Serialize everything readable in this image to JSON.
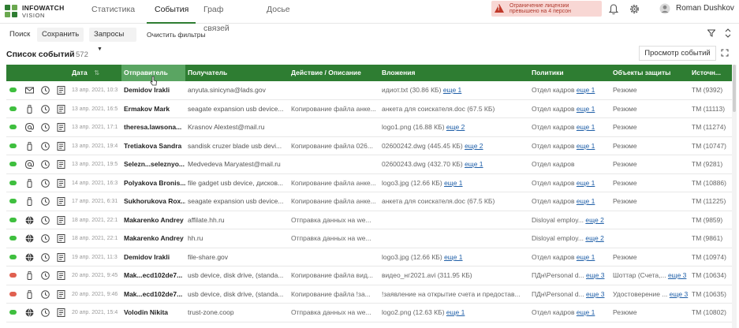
{
  "app": {
    "logo_line1": "INFOWATCH",
    "logo_line2": "VISION",
    "brand_color": "#2e7d32"
  },
  "nav": {
    "items": [
      {
        "label": "Статистика",
        "active": false
      },
      {
        "label": "События",
        "active": true
      },
      {
        "label": "Граф связей",
        "active": false
      },
      {
        "label": "Досье",
        "active": false
      }
    ]
  },
  "license_warning": {
    "line1": "Ограничение лицензии",
    "line2": "превышено на 4 персон"
  },
  "user": {
    "name": "Roman Dushkov"
  },
  "toolbar": {
    "search_label": "Поиск",
    "save_label": "Сохранить",
    "queries_label": "Запросы",
    "clear_filters_label": "Очистить фильтры"
  },
  "list": {
    "title": "Список событий",
    "count": "572",
    "view_button": "Просмотр событий"
  },
  "table": {
    "columns": [
      {
        "key": "date",
        "label": "Дата"
      },
      {
        "key": "sender",
        "label": "Отправитель"
      },
      {
        "key": "recipient",
        "label": "Получатель"
      },
      {
        "key": "action",
        "label": "Действие / Описание"
      },
      {
        "key": "attachments",
        "label": "Вложения"
      },
      {
        "key": "policies",
        "label": "Политики"
      },
      {
        "key": "objects",
        "label": "Объекты защиты"
      },
      {
        "key": "source",
        "label": "Источн..."
      }
    ],
    "sorted_column": "sender",
    "rows": [
      {
        "tag": "green",
        "channel": "mail-icon",
        "date": "13 апр. 2021, 10:3",
        "sender": "Demidov Irakli",
        "recipient": "anyuta.sinicyna@lads.gov",
        "action": "",
        "attachment": "идиот.txt (30.86 КБ)",
        "attachment_more": "еще 1",
        "policy": "Отдел кадров",
        "policy_more": "еще 1",
        "object": "Резюме",
        "object_more": "",
        "source": "TM (9392)"
      },
      {
        "tag": "green",
        "channel": "usb-icon",
        "date": "13 апр. 2021, 16:5",
        "sender": "Ermakov Mark",
        "recipient": "seagate expansion usb device...",
        "action": "Копирование файла анке...",
        "attachment": "анкета для соискателя.doc (67.5 КБ)",
        "attachment_more": "",
        "policy": "Отдел кадров",
        "policy_more": "еще 1",
        "object": "Резюме",
        "object_more": "",
        "source": "TM (11113)"
      },
      {
        "tag": "green",
        "channel": "at-icon",
        "date": "13 апр. 2021, 17:1",
        "sender": "theresa.lawsona...",
        "recipient": "Krasnov Alextest@mail.ru",
        "action": "",
        "attachment": "logo1.png (16.88 КБ)",
        "attachment_more": "еще 2",
        "policy": "Отдел кадров",
        "policy_more": "еще 1",
        "object": "Резюме",
        "object_more": "",
        "source": "TM (11274)"
      },
      {
        "tag": "green",
        "channel": "usb-icon",
        "date": "13 апр. 2021, 19:4",
        "sender": "Tretiakova Sandra",
        "recipient": "sandisk cruzer blade usb devi...",
        "action": "Копирование файла 026...",
        "attachment": "02600242.dwg (445.45 КБ)",
        "attachment_more": "еще 2",
        "policy": "Отдел кадров",
        "policy_more": "еще 1",
        "object": "Резюме",
        "object_more": "",
        "source": "TM (10747)"
      },
      {
        "tag": "green",
        "channel": "at-icon",
        "date": "13 апр. 2021, 19:5",
        "sender": "Selezn...seleznyo...",
        "recipient": "Medvedeva Maryatest@mail.ru",
        "action": "",
        "attachment": "02600243.dwg (432.70 КБ)",
        "attachment_more": "еще 1",
        "policy": "Отдел кадров",
        "policy_more": "",
        "object": "Резюме",
        "object_more": "",
        "source": "TM (9281)"
      },
      {
        "tag": "green",
        "channel": "usb-icon",
        "date": "14 апр. 2021, 16:3",
        "sender": "Polyakova Bronis...",
        "recipient": "file gadget usb device, дисков...",
        "action": "Копирование файла анке...",
        "attachment": "logo3.jpg (12.66 КБ)",
        "attachment_more": "еще 1",
        "policy": "Отдел кадров",
        "policy_more": "еще 1",
        "object": "Резюме",
        "object_more": "",
        "source": "TM (10886)"
      },
      {
        "tag": "green",
        "channel": "usb-icon",
        "date": "17 апр. 2021, 6:31",
        "sender": "Sukhorukova Rox...",
        "recipient": "seagate expansion usb device...",
        "action": "Копирование файла анке...",
        "attachment": "анкета для соискателя.doc (67.5 КБ)",
        "attachment_more": "",
        "policy": "Отдел кадров",
        "policy_more": "еще 1",
        "object": "Резюме",
        "object_more": "",
        "source": "TM (11225)"
      },
      {
        "tag": "green",
        "channel": "globe-icon",
        "date": "18 апр. 2021, 22:1",
        "sender": "Makarenko Andrey",
        "recipient": "affilate.hh.ru",
        "action": "Отправка данных на we...",
        "attachment": "",
        "attachment_more": "",
        "policy": "Disloyal employ...",
        "policy_more": "еще 2",
        "object": "",
        "object_more": "",
        "source": "TM (9859)"
      },
      {
        "tag": "green",
        "channel": "globe-icon",
        "date": "18 апр. 2021, 22:1",
        "sender": "Makarenko Andrey",
        "recipient": "hh.ru",
        "action": "Отправка данных на we...",
        "attachment": "",
        "attachment_more": "",
        "policy": "Disloyal employ...",
        "policy_more": "еще 2",
        "object": "",
        "object_more": "",
        "source": "TM (9861)"
      },
      {
        "tag": "green",
        "channel": "globe-icon",
        "date": "19 апр. 2021, 11:3",
        "sender": "Demidov Irakli",
        "recipient": "file-share.gov",
        "action": "",
        "attachment": "logo3.jpg (12.66 КБ)",
        "attachment_more": "еще 1",
        "policy": "Отдел кадров",
        "policy_more": "еще 1",
        "object": "Резюме",
        "object_more": "",
        "source": "TM (10974)"
      },
      {
        "tag": "red",
        "channel": "usb-icon",
        "date": "20 апр. 2021, 9:45",
        "sender": "Mak...ecd102de7...",
        "recipient": "usb device, disk drive, (standa...",
        "action": "Копирование файла вид...",
        "attachment": "видео_нг2021.avi (311.95 КБ)",
        "attachment_more": "",
        "policy": "ПДн\\Personal d...",
        "policy_more": "еще 3",
        "object": "Шоттар (Счета,...",
        "object_more": "еще 3",
        "source": "TM (10634)"
      },
      {
        "tag": "red",
        "channel": "usb-icon",
        "date": "20 апр. 2021, 9:46",
        "sender": "Mak...ecd102de7...",
        "recipient": "usb device, disk drive, (standa...",
        "action": "Копирование файла !за...",
        "attachment": "!заявление на открытие счета и предостав...",
        "attachment_more": "",
        "policy": "ПДн\\Personal d...",
        "policy_more": "еще 3",
        "object": "Удостоверение ...",
        "object_more": "еще 3",
        "source": "TM (10635)"
      },
      {
        "tag": "green",
        "channel": "globe-icon",
        "date": "20 апр. 2021, 15:4",
        "sender": "Volodin Nikita",
        "recipient": "trust-zone.coop",
        "action": "Отправка данных на we...",
        "attachment": "logo2.png (12.63 КБ)",
        "attachment_more": "еще 1",
        "policy": "Отдел кадров",
        "policy_more": "еще 1",
        "object": "Резюме",
        "object_more": "",
        "source": "TM (10802)"
      }
    ]
  },
  "colors": {
    "header_green": "#2e7d32",
    "sorted_header": "#5aa562",
    "tag_green": "#3fbf3f",
    "tag_red": "#e06050",
    "warning_bg": "#f8d7d4",
    "link": "#1f5fa8"
  }
}
